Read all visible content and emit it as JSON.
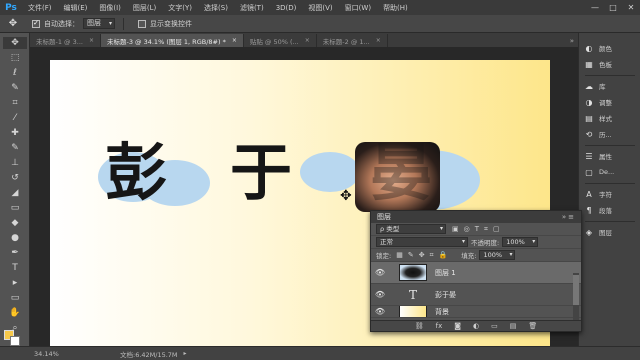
{
  "app": {
    "logo": "Ps"
  },
  "menu": [
    "文件(F)",
    "编辑(E)",
    "图像(I)",
    "图层(L)",
    "文字(Y)",
    "选择(S)",
    "滤镜(T)",
    "3D(D)",
    "视图(V)",
    "窗口(W)",
    "帮助(H)"
  ],
  "window_controls": {
    "minimize": "—",
    "maximize": "□",
    "close": "✕"
  },
  "options": {
    "tool_icon": "move-tool-icon",
    "tool_glyph": "✥",
    "auto_select_checked": "✓",
    "auto_select_label": "自动选择：",
    "auto_select_value": "图层",
    "transform_label": "显示变换控件"
  },
  "tabs": [
    {
      "label": "未标题-1 @ 3...",
      "close": "×"
    },
    {
      "label": "未标题-3 @ 34.1% (图层 1, RGB/8#) *",
      "close": "×"
    },
    {
      "label": "贴贴 @ 50% (...",
      "close": "×"
    },
    {
      "label": "未标题-2 @ 1...",
      "close": "×"
    }
  ],
  "tabs_overflow": "»",
  "tools": [
    {
      "name": "move-tool-icon",
      "glyph": "✥"
    },
    {
      "name": "marquee-tool-icon",
      "glyph": "⬚"
    },
    {
      "name": "lasso-tool-icon",
      "glyph": "ℓ"
    },
    {
      "name": "quick-select-tool-icon",
      "glyph": "✎"
    },
    {
      "name": "crop-tool-icon",
      "glyph": "⌗"
    },
    {
      "name": "eyedropper-tool-icon",
      "glyph": "⁄"
    },
    {
      "name": "healing-brush-tool-icon",
      "glyph": "✚"
    },
    {
      "name": "brush-tool-icon",
      "glyph": "✎"
    },
    {
      "name": "clone-stamp-tool-icon",
      "glyph": "⊥"
    },
    {
      "name": "history-brush-tool-icon",
      "glyph": "↺"
    },
    {
      "name": "eraser-tool-icon",
      "glyph": "◢"
    },
    {
      "name": "gradient-tool-icon",
      "glyph": "▭"
    },
    {
      "name": "blur-tool-icon",
      "glyph": "◆"
    },
    {
      "name": "dodge-tool-icon",
      "glyph": "●"
    },
    {
      "name": "pen-tool-icon",
      "glyph": "✒"
    },
    {
      "name": "type-tool-icon",
      "glyph": "T"
    },
    {
      "name": "path-selection-tool-icon",
      "glyph": "▸"
    },
    {
      "name": "rectangle-tool-icon",
      "glyph": "▭"
    },
    {
      "name": "hand-tool-icon",
      "glyph": "✋"
    },
    {
      "name": "zoom-tool-icon",
      "glyph": "⌕"
    },
    {
      "name": "more-tools-icon",
      "glyph": "…"
    }
  ],
  "colors": {
    "foreground": "#f7c94a",
    "background": "#ffffff",
    "text_fill": "#161616",
    "splash": "#b8d7ef"
  },
  "canvas": {
    "chars": [
      "彭",
      "于",
      "晏"
    ],
    "cursor": "✥"
  },
  "status": {
    "zoom": "34.14%",
    "doc": "文档:6.42M/15.7M",
    "arrow": "▸"
  },
  "dock": [
    {
      "name": "color-panel-icon",
      "glyph": "◐",
      "label": "颜色"
    },
    {
      "name": "swatches-panel-icon",
      "glyph": "▦",
      "label": "色板"
    },
    {
      "name": "libraries-panel-icon",
      "glyph": "☁",
      "label": "库"
    },
    {
      "name": "adjustments-panel-icon",
      "glyph": "◑",
      "label": "调整"
    },
    {
      "name": "styles-panel-icon",
      "glyph": "▤",
      "label": "样式"
    },
    {
      "name": "history-panel-icon",
      "glyph": "⟲",
      "label": "历..."
    },
    {
      "name": "properties-panel-icon",
      "glyph": "☰",
      "label": "属性"
    },
    {
      "name": "device-preview-panel-icon",
      "glyph": "▢",
      "label": "De..."
    },
    {
      "name": "character-panel-icon",
      "glyph": "A",
      "label": "字符"
    },
    {
      "name": "paragraph-panel-icon",
      "glyph": "¶",
      "label": "段落"
    },
    {
      "name": "layers-panel-icon",
      "glyph": "◈",
      "label": "图层"
    }
  ],
  "layers_panel": {
    "title": "图层",
    "head_ctl": "»≡",
    "filter_value": "ρ 类型",
    "filter_icons": [
      "▣",
      "◎",
      "T",
      "⌗",
      "▢"
    ],
    "blend_mode": "正常",
    "opacity_label": "不透明度:",
    "opacity_value": "100%",
    "lock_label": "锁定:",
    "lock_icons": [
      "▦",
      "✎",
      "✥",
      "⌗",
      "🔒"
    ],
    "fill_label": "填充:",
    "fill_value": "100%",
    "eye": "👁",
    "type_glyph": "T",
    "layers": [
      {
        "name": "图层 1",
        "active": true
      },
      {
        "name": "彭于晏",
        "type": "text"
      },
      {
        "name": "背景",
        "lock": "🔒"
      }
    ],
    "footer_icons": [
      "⛓",
      "fx",
      "◙",
      "◐",
      "▭",
      "▤",
      "🗑"
    ]
  }
}
